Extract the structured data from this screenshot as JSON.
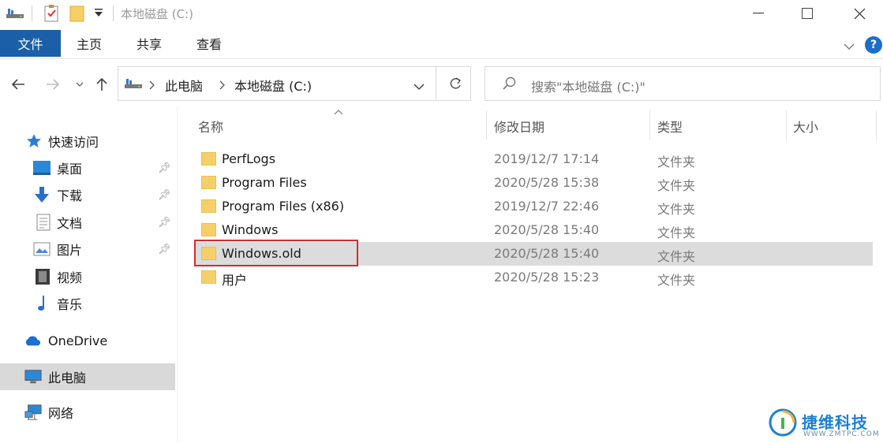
{
  "window": {
    "title": "本地磁盘 (C:)",
    "controls": {
      "minimize": "—",
      "maximize": "☐",
      "close": "✕"
    }
  },
  "ribbon": {
    "file_tab": "文件",
    "tabs": [
      "主页",
      "共享",
      "查看"
    ]
  },
  "address": {
    "crumbs": [
      "此电脑",
      "本地磁盘 (C:)"
    ]
  },
  "search": {
    "placeholder": "搜索\"本地磁盘 (C:)\""
  },
  "sidebar": {
    "quick_access": "快速访问",
    "items": [
      {
        "label": "桌面",
        "icon": "desktop-icon",
        "pinned": true
      },
      {
        "label": "下载",
        "icon": "download-icon",
        "pinned": true
      },
      {
        "label": "文档",
        "icon": "document-icon",
        "pinned": true
      },
      {
        "label": "图片",
        "icon": "pictures-icon",
        "pinned": true
      },
      {
        "label": "视频",
        "icon": "video-icon",
        "pinned": false
      },
      {
        "label": "音乐",
        "icon": "music-icon",
        "pinned": false
      }
    ],
    "onedrive": "OneDrive",
    "this_pc": "此电脑",
    "network": "网络"
  },
  "filelist": {
    "columns": {
      "name": "名称",
      "modified": "修改日期",
      "type": "类型",
      "size": "大小"
    },
    "rows": [
      {
        "name": "PerfLogs",
        "modified": "2019/12/7 17:14",
        "type": "文件夹"
      },
      {
        "name": "Program Files",
        "modified": "2020/5/28 15:38",
        "type": "文件夹"
      },
      {
        "name": "Program Files (x86)",
        "modified": "2019/12/7 22:46",
        "type": "文件夹"
      },
      {
        "name": "Windows",
        "modified": "2020/5/28 15:40",
        "type": "文件夹"
      },
      {
        "name": "Windows.old",
        "modified": "2020/5/28 15:40",
        "type": "文件夹",
        "selected": true
      },
      {
        "name": "用户",
        "modified": "2020/5/28 15:23",
        "type": "文件夹"
      }
    ]
  },
  "watermark": {
    "brand": "捷维科技",
    "domain": "WWW.ZMTPC.COM"
  },
  "colors": {
    "accent": "#1a5fa8",
    "highlight": "#d62b2b",
    "folder": "#f5cf67"
  }
}
